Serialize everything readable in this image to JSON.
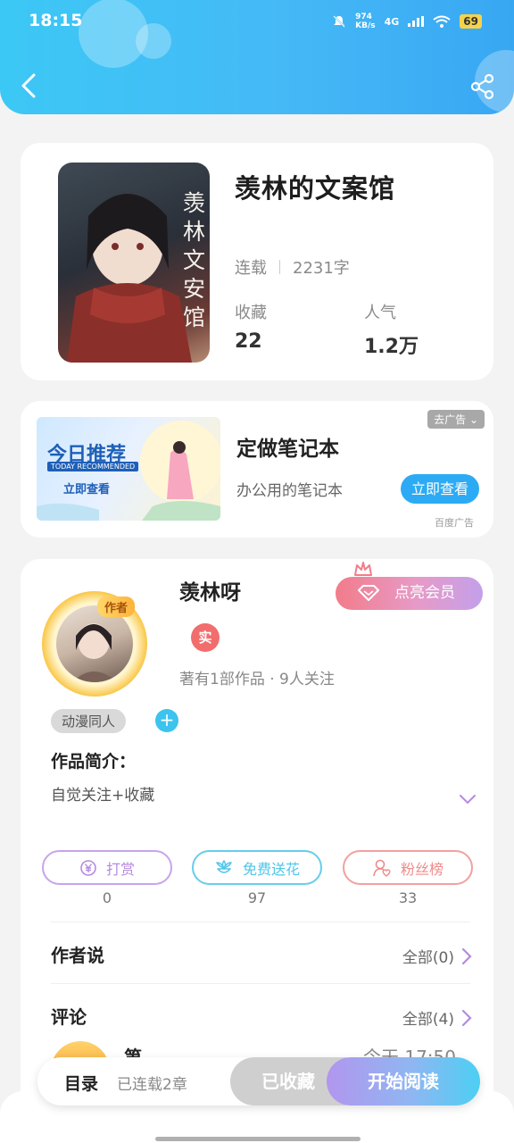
{
  "status_bar": {
    "time": "18:15",
    "net_speed_value": "974",
    "net_speed_unit": "KB/s",
    "network": "4G",
    "battery": "69"
  },
  "book": {
    "title": "羡林的文案馆",
    "status": "连载",
    "word_count": "2231字",
    "favorites_label": "收藏",
    "favorites_value": "22",
    "popularity_label": "人气",
    "popularity_value": "1.2万",
    "cover_text": "羡林文安馆"
  },
  "ad": {
    "image_title": "今日推荐",
    "image_subtitle": "TODAY RECOMMENDED",
    "image_cta": "立即查看",
    "title": "定做笔记本",
    "description": "办公用的笔记本",
    "button": "立即查看",
    "close_label": "去广告",
    "source": "百度广告"
  },
  "author": {
    "badge": "作者",
    "name": "羡林呀",
    "verify": "实",
    "info": "著有1部作品 · 9人关注",
    "vip_button": "点亮会员"
  },
  "work": {
    "tag": "动漫同人",
    "tag_add": "+",
    "intro_label": "作品简介：",
    "intro_text": "自觉关注+收藏"
  },
  "actions": [
    {
      "label": "打赏",
      "count": "0",
      "color": "#b58ae0"
    },
    {
      "label": "免费送花",
      "count": "97",
      "color": "#4fc6e8"
    },
    {
      "label": "粉丝榜",
      "count": "33",
      "color": "#f08a8a"
    }
  ],
  "sections": {
    "author_says": "作者说",
    "author_says_link": "全部(0)",
    "comments": "评论",
    "comments_link": "全部(4)",
    "comment_preview_name": "第",
    "comment_preview_time": "今天 17:50"
  },
  "bottom_bar": {
    "catalog": "目录",
    "chapters": "已连载2章",
    "collected": "已收藏",
    "read": "开始阅读"
  }
}
